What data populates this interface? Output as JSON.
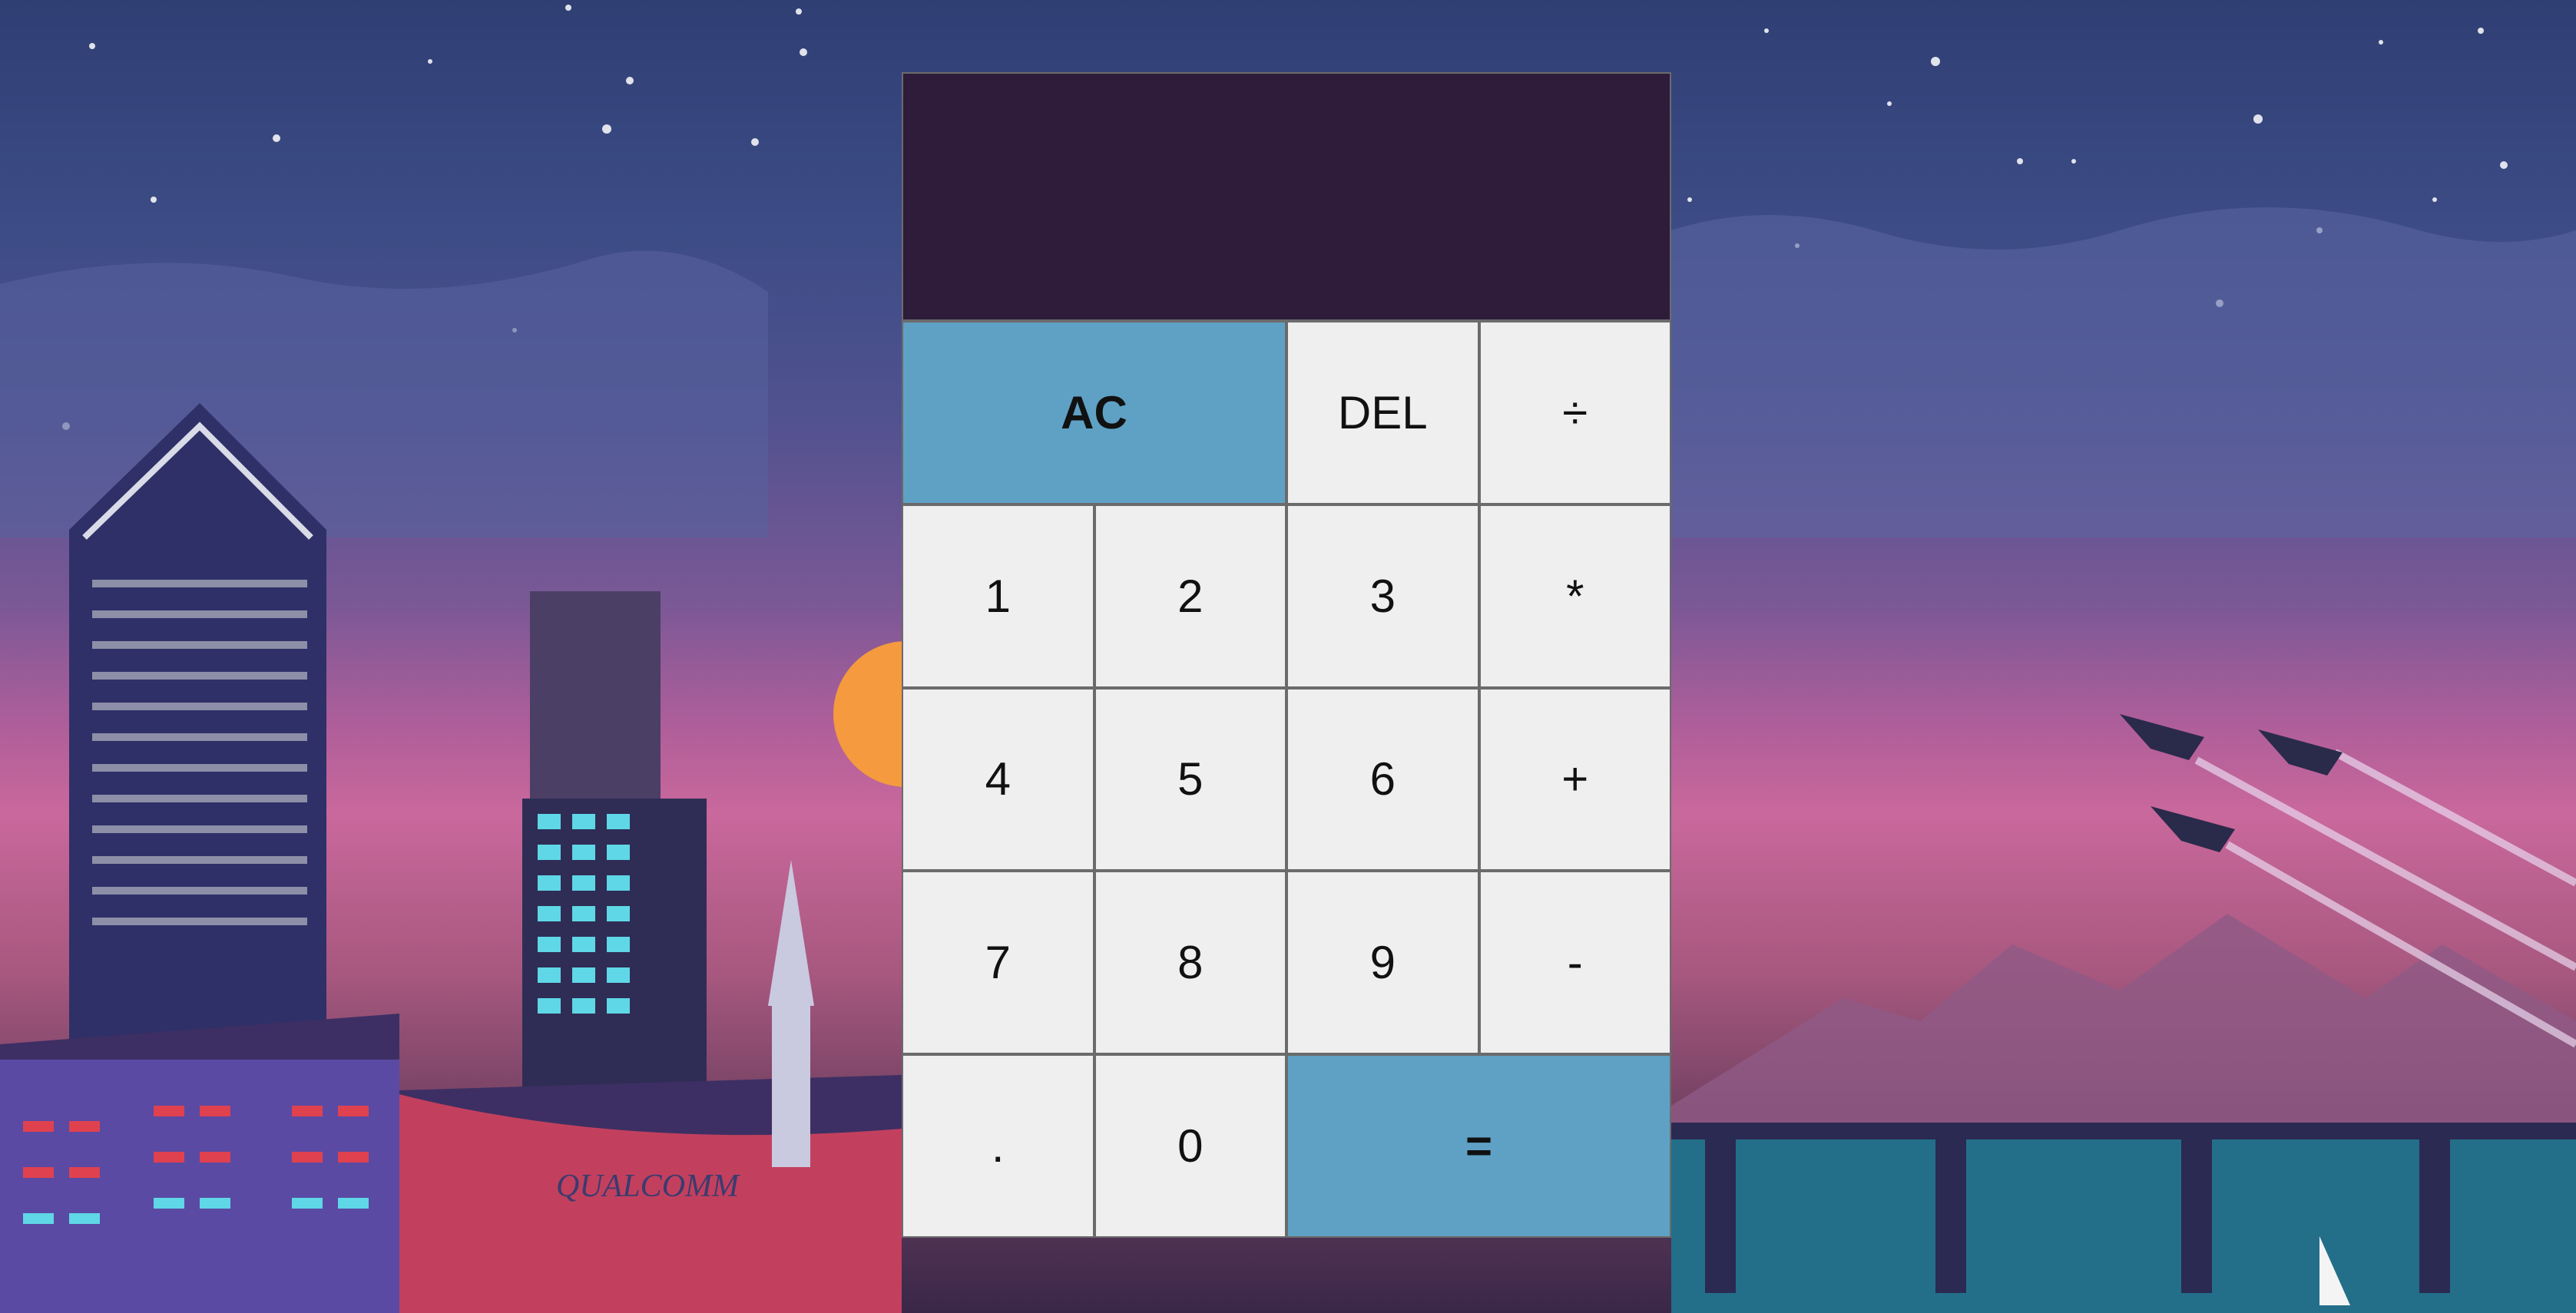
{
  "calculator": {
    "display": {
      "previous_operand": "",
      "current_operand": ""
    },
    "keys": {
      "all_clear": "AC",
      "delete": "DEL",
      "divide": "÷",
      "one": "1",
      "two": "2",
      "three": "3",
      "multiply": "*",
      "four": "4",
      "five": "5",
      "six": "6",
      "add": "+",
      "seven": "7",
      "eight": "8",
      "nine": "9",
      "subtract": "-",
      "decimal": ".",
      "zero": "0",
      "equals": "="
    }
  },
  "background": {
    "logo_text": "QUALCOMM"
  },
  "colors": {
    "display_bg": "#2e1c3a",
    "key_bg": "#efefef",
    "accent_key_bg": "#5fa1c5",
    "sky_top": "#2f3f74",
    "sky_horizon": "#c9689c",
    "sun": "#f59a3e",
    "water": "#236f8a"
  }
}
